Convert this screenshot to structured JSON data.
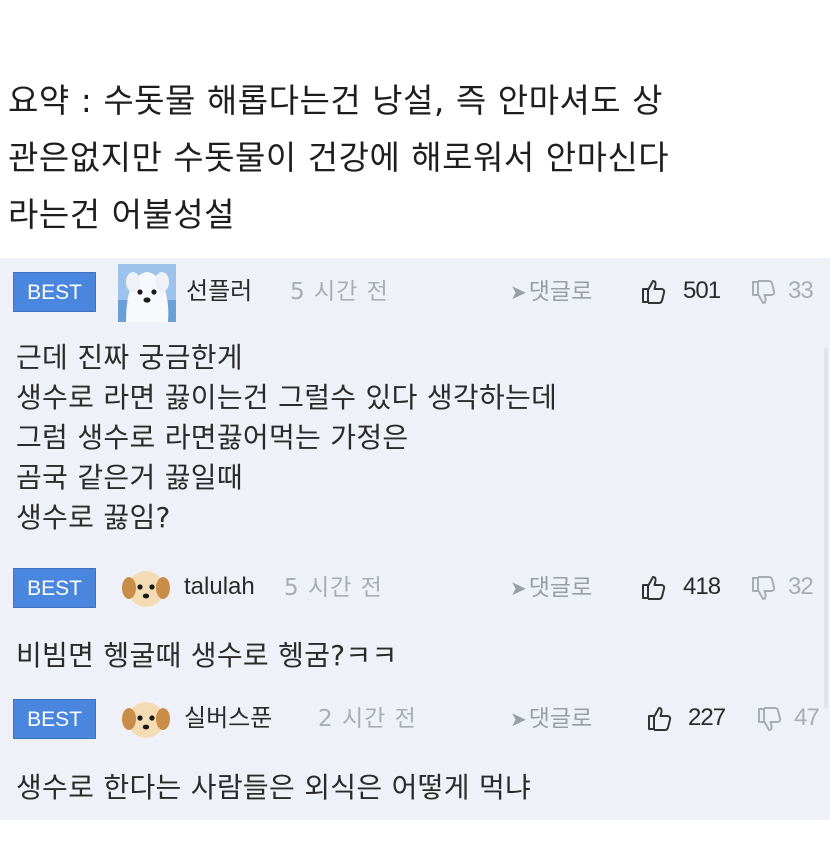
{
  "summary": {
    "lines": [
      "요약 : 수돗물 해롭다는건 낭설, 즉 안마셔도 상",
      "관은없지만 수돗물이 건강에 해로워서 안마신다",
      "라는건 어불성설"
    ]
  },
  "comments": [
    {
      "badge": "BEST",
      "nickname": "선플러",
      "time": "5 시간 전",
      "reply_label": "댓글로",
      "likes": "501",
      "dislikes": "33",
      "avatar": "dog-avatar-icon",
      "body": [
        "근데 진짜 궁금한게",
        "생수로 라면 끓이는건 그럴수 있다 생각하는데",
        "그럼 생수로 라면끓어먹는 가정은",
        "곰국 같은거 끓일때",
        "생수로 끓임?"
      ]
    },
    {
      "badge": "BEST",
      "nickname": "talulah",
      "time": "5 시간 전",
      "reply_label": "댓글로",
      "likes": "418",
      "dislikes": "32",
      "avatar": "puppy-avatar-icon",
      "body": [
        "비빔면 헹굴때 생수로 헹굼?ㅋㅋ"
      ]
    },
    {
      "badge": "BEST",
      "nickname": "실버스푼",
      "time": "2 시간 전",
      "reply_label": "댓글로",
      "likes": "227",
      "dislikes": "47",
      "avatar": "puppy-avatar-icon",
      "body": [
        "생수로 한다는 사람들은 외식은 어떻게 먹냐"
      ]
    }
  ],
  "colors": {
    "best_badge": "#4a86dd",
    "comment_bg": "#eef1f7",
    "muted_text": "#a9adb4"
  }
}
